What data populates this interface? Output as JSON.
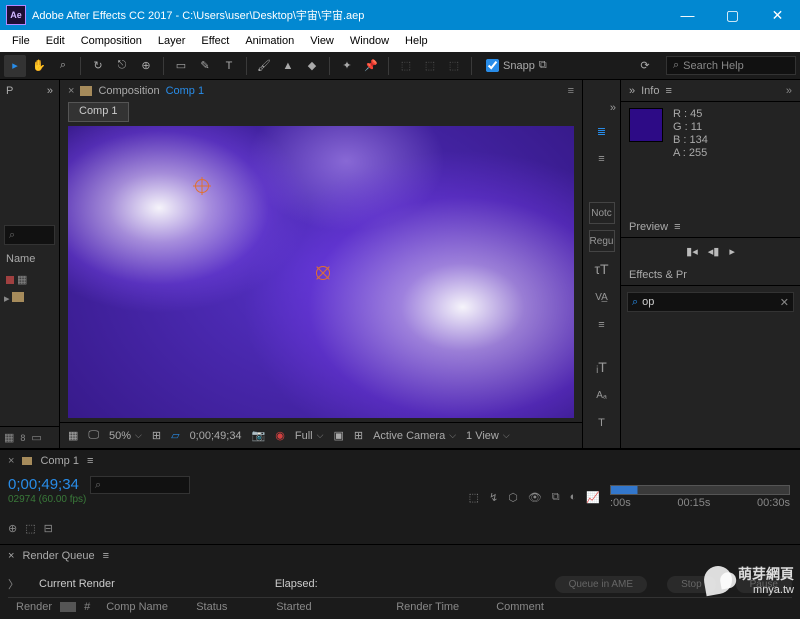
{
  "titlebar": {
    "logo": "Ae",
    "title": "Adobe After Effects CC 2017 - C:\\Users\\user\\Desktop\\宇宙\\宇宙.aep"
  },
  "menu": [
    "File",
    "Edit",
    "Composition",
    "Layer",
    "Effect",
    "Animation",
    "View",
    "Window",
    "Help"
  ],
  "toolbar": {
    "snapping_label": "Snapp",
    "search_placeholder": "Search Help"
  },
  "project_panel": {
    "tab": "P",
    "name_label": "Name"
  },
  "composition": {
    "panel_label": "Composition",
    "name": "Comp 1",
    "tab_name": "Comp 1"
  },
  "viewer_controls": {
    "zoom": "50%",
    "timecode": "0;00;49;34",
    "resolution": "Full",
    "camera": "Active Camera",
    "view_count": "1 View"
  },
  "right_strip": {
    "notch": "Notc",
    "regular": "Regu"
  },
  "info": {
    "title": "Info",
    "r_label": "R :",
    "r": "45",
    "g_label": "G :",
    "g": "11",
    "b_label": "B :",
    "b": "134",
    "a_label": "A :",
    "a": "255",
    "swatch_color": "#2d0b86"
  },
  "preview": {
    "title": "Preview"
  },
  "effects": {
    "title": "Effects & Pr",
    "search_value": "op"
  },
  "timeline": {
    "comp_name": "Comp 1",
    "timecode": "0;00;49;34",
    "frames": "02974 (60.00 fps)",
    "ruler_ticks": [
      ":00s",
      "00:15s",
      "00:30s"
    ]
  },
  "render_queue": {
    "title": "Render Queue",
    "current_label": "Current Render",
    "elapsed_label": "Elapsed:",
    "btn_queue": "Queue in AME",
    "btn_stop": "Stop",
    "btn_pause": "Pause",
    "cols": [
      "Render",
      "",
      "#",
      "Comp Name",
      "Status",
      "Started",
      "Render Time",
      "Comment"
    ]
  },
  "watermark": {
    "line1": "萌芽網頁",
    "line2": "mnya.tw"
  }
}
